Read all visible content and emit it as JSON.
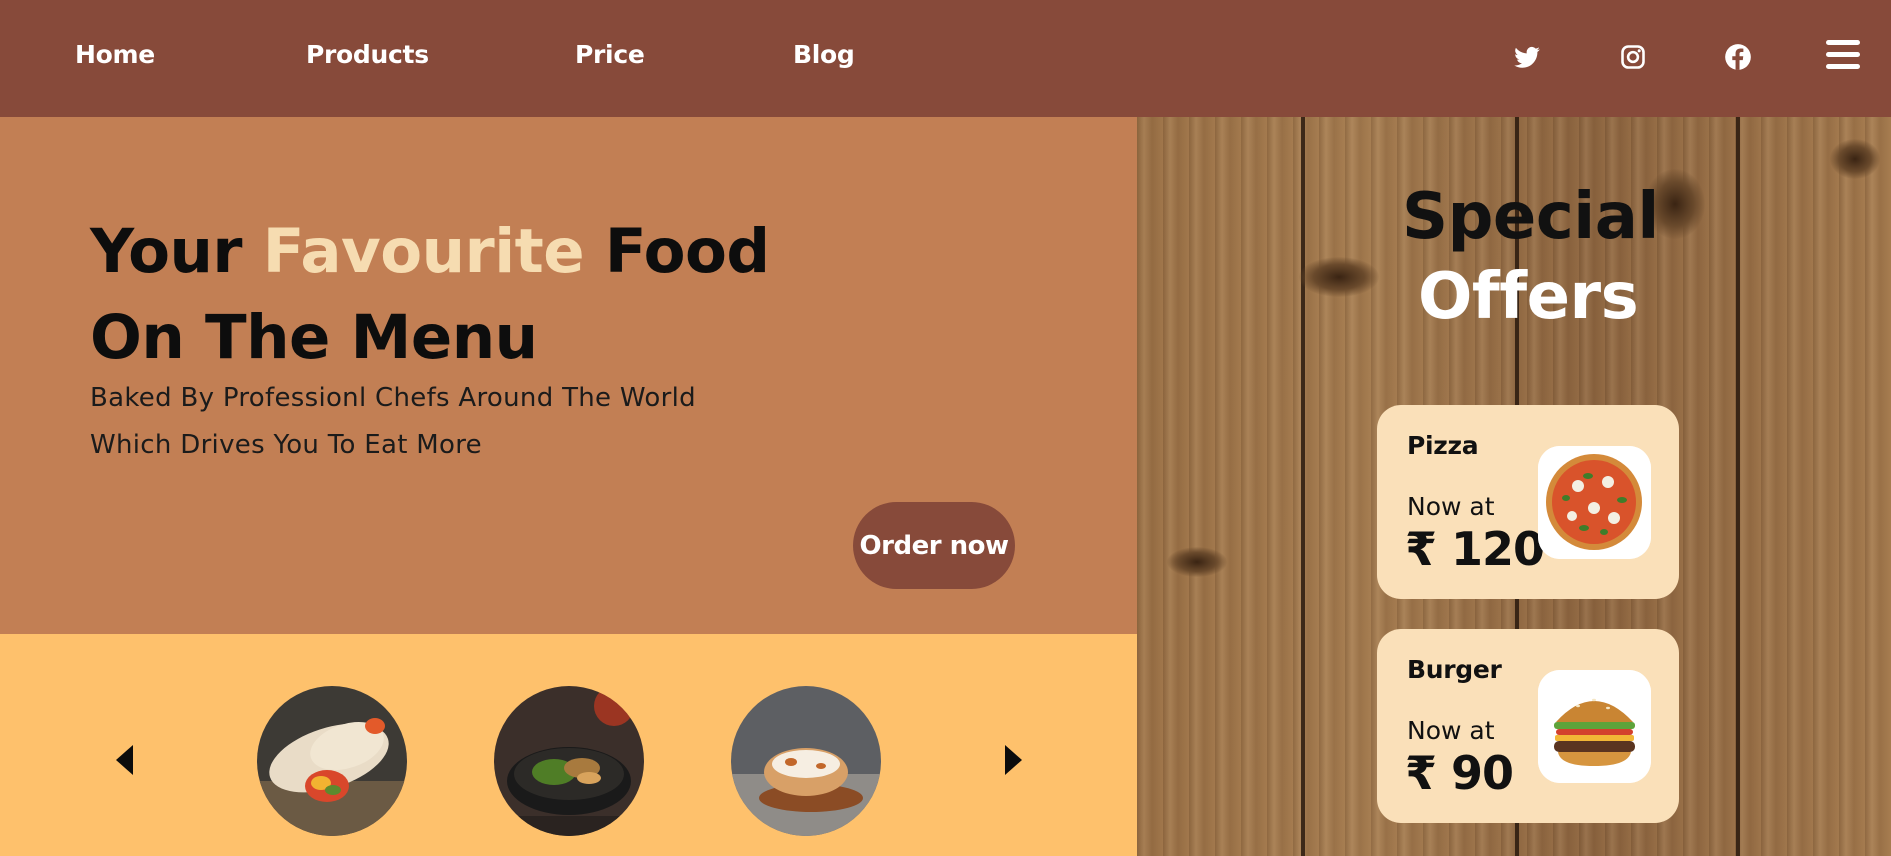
{
  "nav": {
    "items": [
      {
        "label": "Home"
      },
      {
        "label": "Products"
      },
      {
        "label": "Price"
      },
      {
        "label": "Blog"
      }
    ],
    "social_icons": [
      "twitter-icon",
      "instagram-icon",
      "facebook-icon"
    ],
    "menu_icon": "hamburger-menu-icon"
  },
  "hero": {
    "title_part1": "Your",
    "title_highlight": "Favourite",
    "title_part2": "Food",
    "title_line2": "On The Menu",
    "subtitle_line1": "Baked By Professionl Chefs Around The World",
    "subtitle_line2": "Which Drives You To Eat More",
    "cta_label": "Order now"
  },
  "carousel": {
    "prev_icon": "caret-left-icon",
    "next_icon": "caret-right-icon",
    "items": [
      {
        "name": "wrap-image"
      },
      {
        "name": "noodle-bowl-image"
      },
      {
        "name": "pastry-image"
      }
    ]
  },
  "offers": {
    "heading_line1": "Special",
    "heading_line2": "Offers",
    "cards": [
      {
        "name": "Pizza",
        "now_label": "Now at",
        "price": "₹ 120",
        "image": "pizza-image"
      },
      {
        "name": "Burger",
        "now_label": "Now at",
        "price": "₹ 90",
        "image": "burger-image"
      }
    ]
  },
  "colors": {
    "header_bg": "#874a3a",
    "hero_bg": "#c27f54",
    "highlight": "#f6dcb1",
    "carousel_bg": "#fec16c",
    "card_bg": "#fae0b9",
    "button_bg": "#874a3a"
  }
}
